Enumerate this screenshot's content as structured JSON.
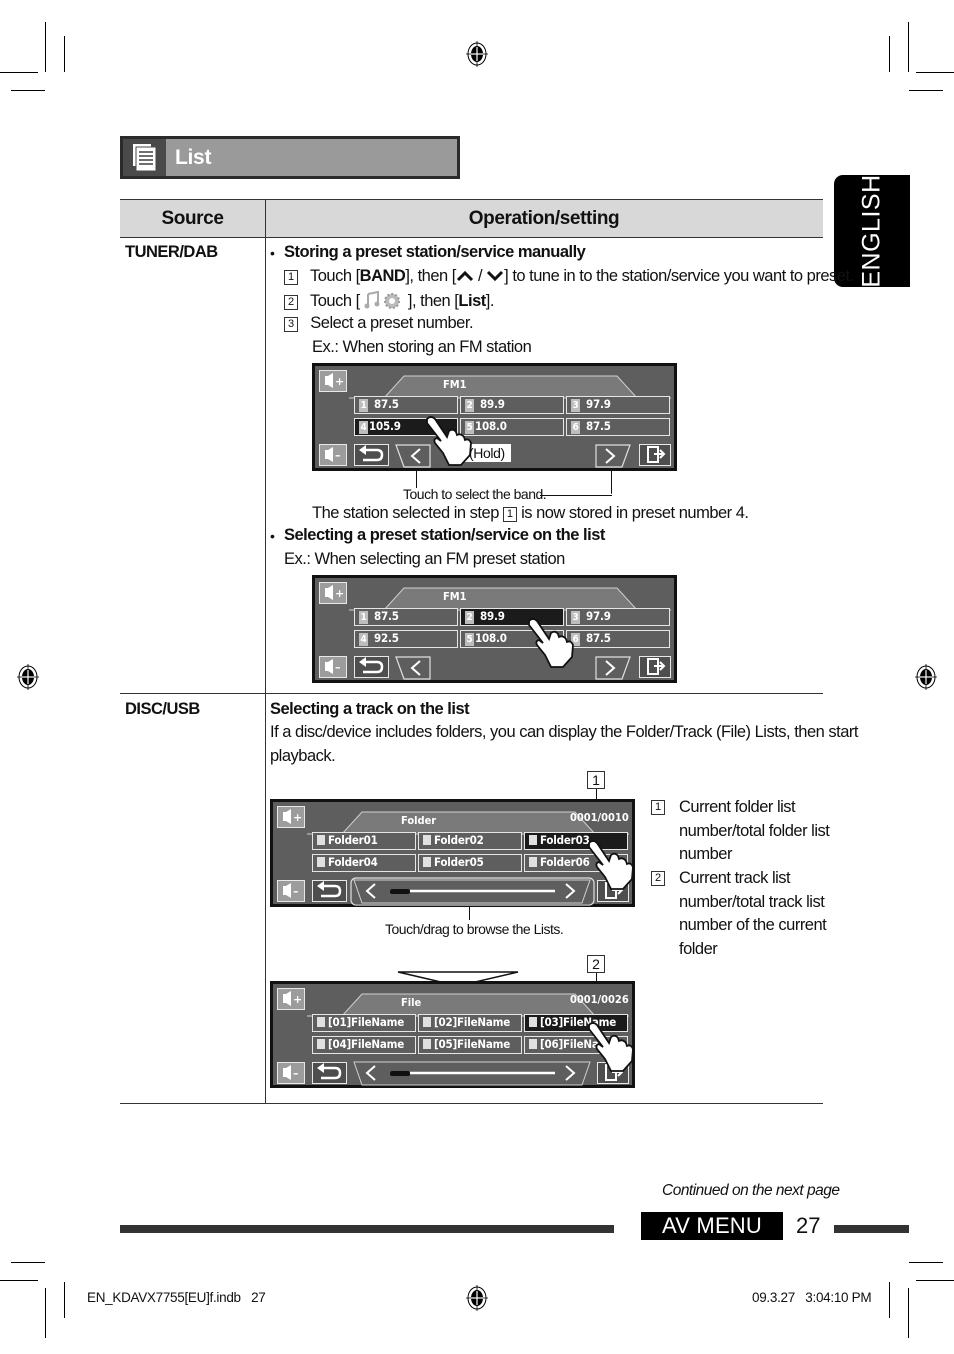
{
  "section_title": {
    "icon": "list-icon",
    "label": "List"
  },
  "language_tab": "ENGLISH",
  "table": {
    "headers": [
      "Source",
      "Operation/setting"
    ],
    "rows": [
      {
        "source": "TUNER/DAB",
        "sections": {
          "storing": {
            "heading": "Storing a preset station/service manually",
            "steps": [
              {
                "num": "1",
                "pre": "Touch [",
                "bold1": "BAND",
                "mid": "], then [",
                "icons": "up-arrow / down-arrow",
                "post": "] to tune in to the station/service you want to preset."
              },
              {
                "num": "2",
                "pre": "Touch [",
                "icon": "music-settings-icon",
                "mid": "], then [",
                "bold1": "List",
                "post": "]."
              },
              {
                "num": "3",
                "text": "Select a preset number."
              }
            ],
            "example": "Ex.: When storing an FM station",
            "screen": {
              "band": "FM1",
              "presets": [
                {
                  "n": "1",
                  "freq": "87.5"
                },
                {
                  "n": "2",
                  "freq": "89.9"
                },
                {
                  "n": "3",
                  "freq": "97.9"
                },
                {
                  "n": "4",
                  "freq": "105.9",
                  "selected": true
                },
                {
                  "n": "5",
                  "freq": "108.0"
                },
                {
                  "n": "6",
                  "freq": "87.5"
                }
              ],
              "hold_label": "(Hold)"
            },
            "band_caption": "Touch to select the band.",
            "result_pre": "The station selected in step",
            "result_num": "1",
            "result_post": "is now stored in preset number 4."
          },
          "selecting": {
            "heading": "Selecting a preset station/service on the list",
            "example": "Ex.: When selecting an FM preset station",
            "screen": {
              "band": "FM1",
              "presets": [
                {
                  "n": "1",
                  "freq": "87.5"
                },
                {
                  "n": "2",
                  "freq": "89.9",
                  "selected": true
                },
                {
                  "n": "3",
                  "freq": "97.9"
                },
                {
                  "n": "4",
                  "freq": "92.5"
                },
                {
                  "n": "5",
                  "freq": "108.0"
                },
                {
                  "n": "6",
                  "freq": "87.5"
                }
              ]
            }
          }
        }
      },
      {
        "source": "DISC/USB",
        "heading": "Selecting a track on the list",
        "body_line1": "If a disc/device includes folders, you can display the Folder/Track (File) Lists, then start",
        "body_line2": "playback.",
        "folder_screen": {
          "label": "Folder",
          "counter": "0001/0010",
          "callout": "1",
          "items": [
            "Folder01",
            "Folder02",
            "Folder03",
            "Folder04",
            "Folder05",
            "Folder06"
          ],
          "selected_index": 2
        },
        "browse_caption": "Touch/drag to browse the Lists.",
        "file_screen": {
          "label": "File",
          "counter": "0001/0026",
          "callout": "2",
          "items": [
            "[01]FileName",
            "[02]FileName",
            "[03]FileName",
            "[04]FileName",
            "[05]FileName",
            "[06]FileName"
          ],
          "selected_index": 2
        },
        "legend": [
          {
            "num": "1",
            "lines": [
              "Current folder list",
              "number/total folder list",
              "number"
            ]
          },
          {
            "num": "2",
            "lines": [
              "Current track list",
              "number/total track list",
              "number of the current",
              "folder"
            ]
          }
        ]
      }
    ]
  },
  "footer": {
    "continued": "Continued on the next page",
    "section": "AV MENU",
    "page": "27",
    "slug_left": "EN_KDAVX7755[EU]f.indb   27",
    "slug_right": "09.3.27   3:04:10 PM"
  }
}
